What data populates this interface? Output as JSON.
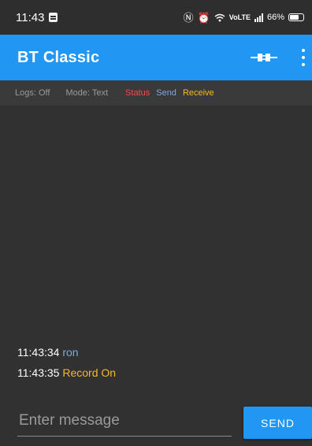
{
  "status_bar": {
    "time": "11:43",
    "volte": "VoLTE",
    "battery": "66%",
    "battery_level": 0.66
  },
  "app_bar": {
    "title": "BT Classic",
    "connect_icon": "plug-icon",
    "menu_icon": "more-vert-icon"
  },
  "info_bar": {
    "logs": "Logs: Off",
    "mode": "Mode: Text",
    "status": "Status",
    "send": "Send",
    "receive": "Receive"
  },
  "log": [
    {
      "time": "11:43:34",
      "text": "ron",
      "type": "send"
    },
    {
      "time": "11:43:35",
      "text": "Record On",
      "type": "receive"
    }
  ],
  "input": {
    "placeholder": "Enter message",
    "value": ""
  },
  "send_button": "SEND",
  "colors": {
    "accent": "#2196f3",
    "status": "#f04b4b",
    "send": "#7ea6e0",
    "receive": "#f5b82e",
    "background": "#313131"
  }
}
